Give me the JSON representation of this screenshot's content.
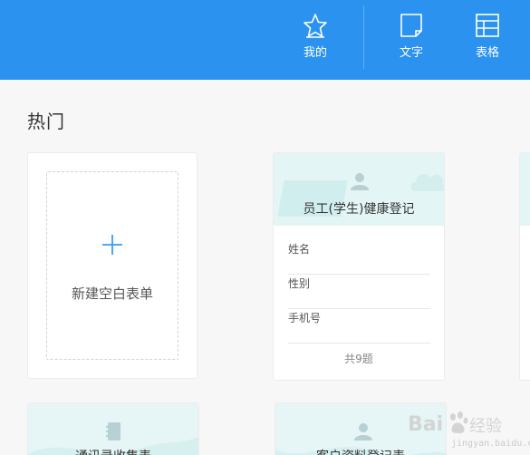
{
  "nav": {
    "items": [
      {
        "label": "我的",
        "icon": "star-icon"
      },
      {
        "label": "文字",
        "icon": "document-icon"
      },
      {
        "label": "表格",
        "icon": "table-icon"
      }
    ]
  },
  "hot": {
    "title": "热门",
    "new_card_label": "新建空白表单",
    "template": {
      "title": "员工(学生)健康登记",
      "fields": [
        "姓名",
        "性别",
        "手机号"
      ],
      "count": "共9题"
    },
    "bottom_cards": [
      {
        "title": "通讯录收集表"
      },
      {
        "title": "客户资料登记表"
      }
    ]
  },
  "watermark": {
    "brand": "Bai",
    "suffix": "经验",
    "sub": "jingyan.baidu.com"
  },
  "colors": {
    "topbar": "#2b93ef",
    "accent": "#2b93ef",
    "card_tint": "#e4f5f5"
  }
}
